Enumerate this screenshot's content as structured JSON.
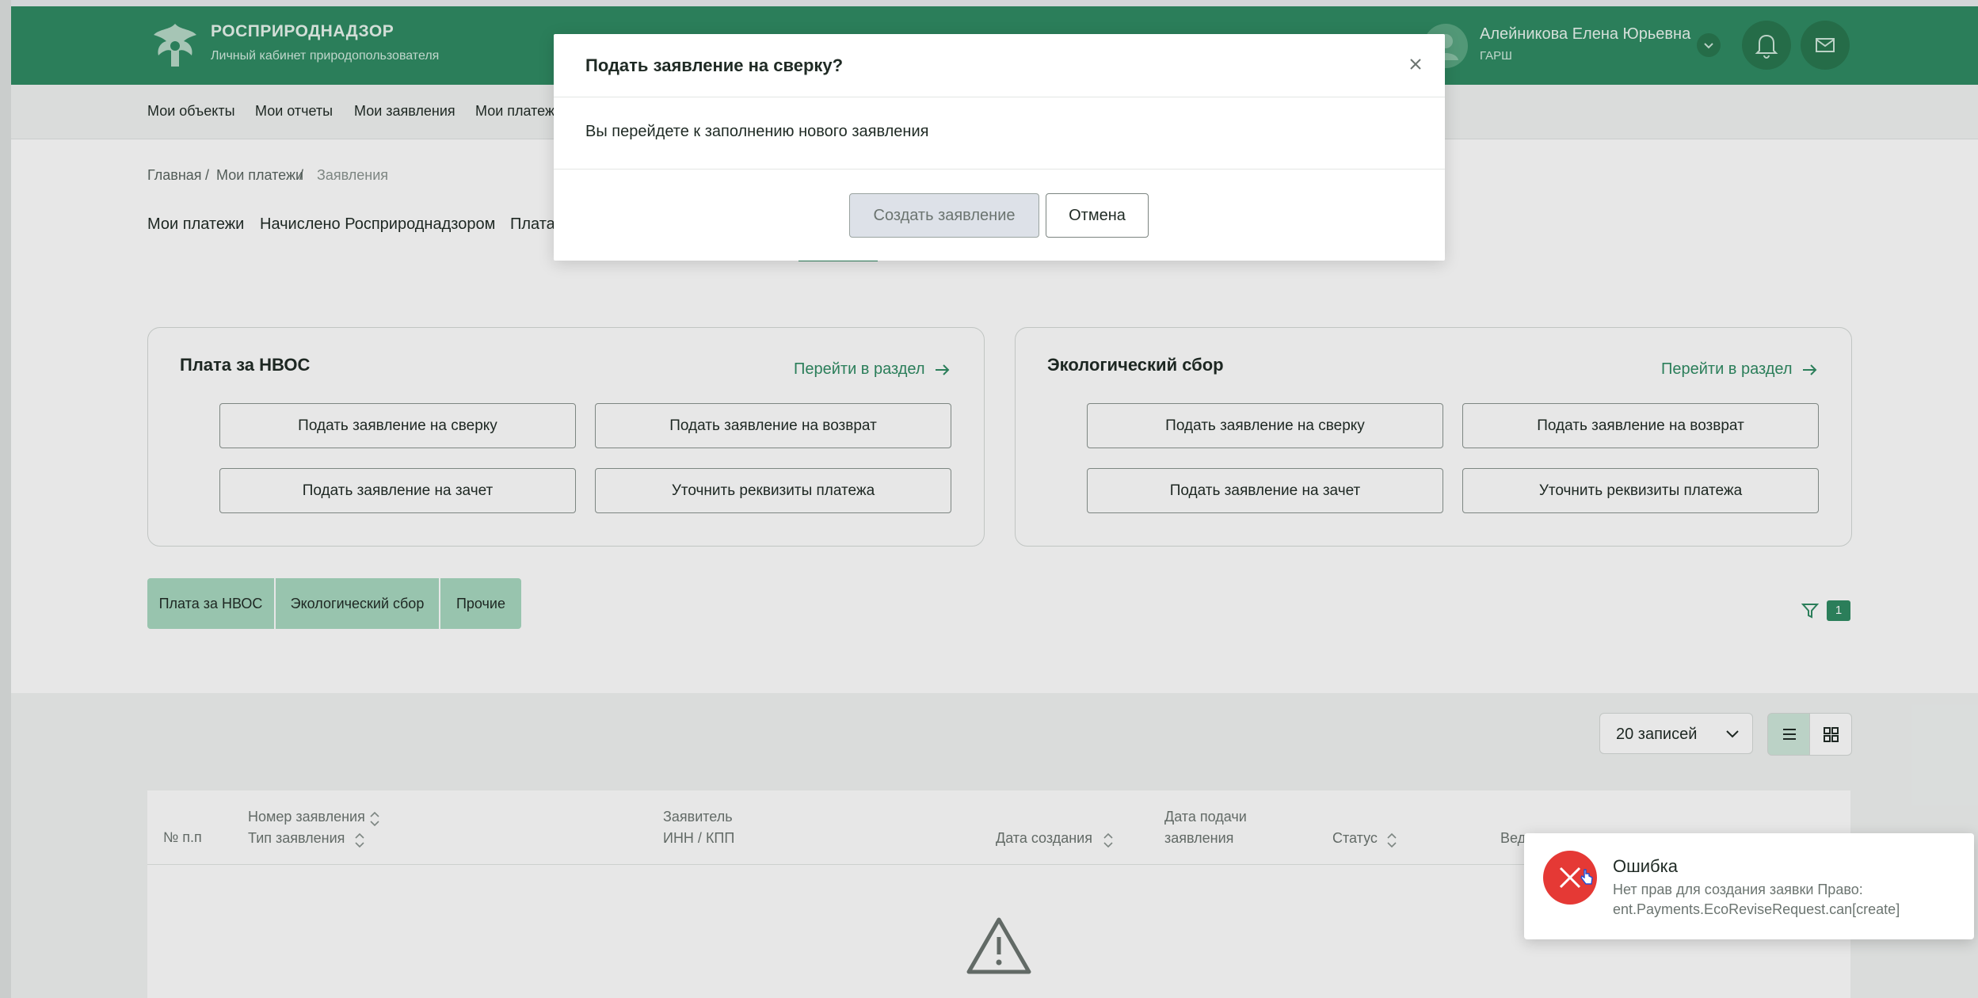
{
  "header": {
    "brand_title": "РОСПРИРОДНАДЗОР",
    "brand_subtitle": "Личный кабинет природопользователя",
    "user_name": "Алейникова Елена Юрьевна",
    "user_org": "ГАРШ",
    "brand_color": "#2e8b62"
  },
  "nav": {
    "items": [
      "Мои объекты",
      "Мои отчеты",
      "Мои заявления",
      "Мои платежи"
    ]
  },
  "breadcrumb": [
    "Главная",
    "/",
    "Мои платежи",
    "/",
    "Заявления"
  ],
  "subtabs": [
    "Мои платежи",
    "Начислено Росприроднадзором",
    "Плата"
  ],
  "cards": [
    {
      "title": "Плата за НВОС",
      "link": "Перейти в раздел",
      "buttons": [
        "Подать заявление на сверку",
        "Подать заявление на возврат",
        "Подать заявление на зачет",
        "Уточнить реквизиты платежа"
      ]
    },
    {
      "title": "Экологический сбор",
      "link": "Перейти в раздел",
      "buttons": [
        "Подать заявление на сверку",
        "Подать заявление на возврат",
        "Подать заявление на зачет",
        "Уточнить реквизиты платежа"
      ]
    }
  ],
  "segments": [
    "Плата за НВОС",
    "Экологический сбор",
    "Прочие"
  ],
  "filter_count": "1",
  "page_size": "20 записей",
  "table_headers": {
    "num": "№ п.п",
    "number": "Номер заявления",
    "type": "Тип заявления",
    "applicant": "Заявитель",
    "inn": "ИНН / КПП",
    "created": "Дата создания",
    "submit_1": "Дата подачи",
    "submit_2": "заявления",
    "status": "Статус",
    "ved": "Вед"
  },
  "modal": {
    "title": "Подать заявление на сверку?",
    "body": "Вы перейдете к заполнению нового заявления",
    "create_label": "Создать заявление",
    "cancel_label": "Отмена"
  },
  "toast": {
    "title": "Ошибка",
    "message": "Нет прав для создания заявки Право: ent.Payments.EcoReviseRequest.can[create]",
    "color": "#e53935"
  }
}
